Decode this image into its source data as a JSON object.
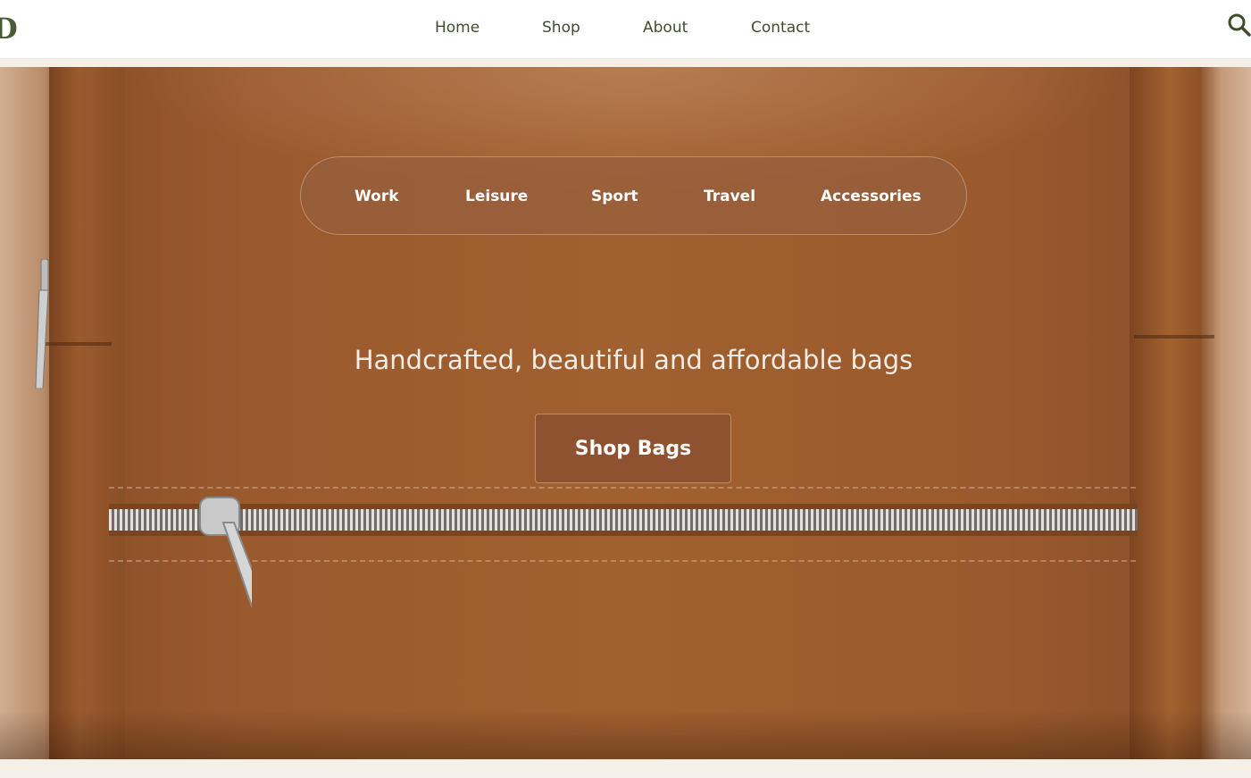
{
  "header": {
    "logo": "D",
    "nav": [
      "Home",
      "Shop",
      "About",
      "Contact"
    ],
    "search_icon": "search-icon"
  },
  "hero": {
    "categories": [
      "Work",
      "Leisure",
      "Sport",
      "Travel",
      "Accessories"
    ],
    "tagline": "Handcrafted, beautiful and affordable bags",
    "cta_label": "Shop Bags"
  },
  "colors": {
    "nav_text": "#3f4d2e",
    "leather": "#9a5a2e",
    "page_bg": "#f4efe7"
  }
}
